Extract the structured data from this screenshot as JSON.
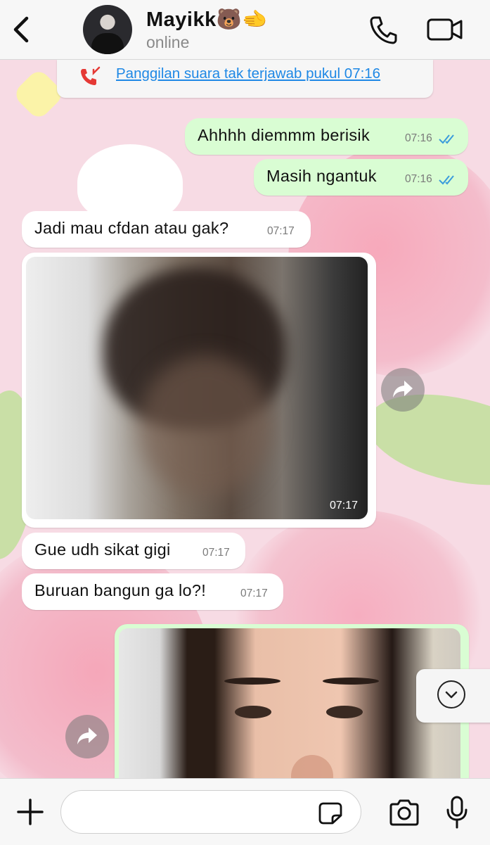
{
  "header": {
    "back_icon": "chevron-left-icon",
    "contact_name": "Mayikk🐻🫲",
    "contact_status": "online",
    "call_icon": "phone-icon",
    "video_icon": "video-camera-icon"
  },
  "missed_call": {
    "icon": "missed-call-icon",
    "text": "Panggilan suara tak terjawab pukul 07:16"
  },
  "messages": [
    {
      "direction": "out",
      "text": "Ahhhh diemmm berisik",
      "time": "07:16",
      "read": true
    },
    {
      "direction": "out",
      "text": "Masih ngantuk",
      "time": "07:16",
      "read": true
    },
    {
      "direction": "in",
      "text": "Jadi mau cfdan atau gak?",
      "time": "07:17"
    },
    {
      "direction": "in",
      "type": "photo",
      "time": "07:17"
    },
    {
      "direction": "in",
      "text": "Gue udh sikat gigi",
      "time": "07:17"
    },
    {
      "direction": "in",
      "text": "Buruan bangun ga lo?!",
      "time": "07:17"
    },
    {
      "direction": "out",
      "type": "photo"
    }
  ],
  "composer": {
    "placeholder": "",
    "plus_icon": "plus-icon",
    "sticker_icon": "sticker-icon",
    "camera_icon": "camera-icon",
    "mic_icon": "microphone-icon"
  },
  "colors": {
    "outgoing_bubble": "#d9fdd3",
    "incoming_bubble": "#ffffff",
    "link_blue": "#1e88e5",
    "missed_red": "#e53935",
    "read_ticks": "#3a9bdc",
    "wallpaper_pink": "#f7dbe4"
  }
}
